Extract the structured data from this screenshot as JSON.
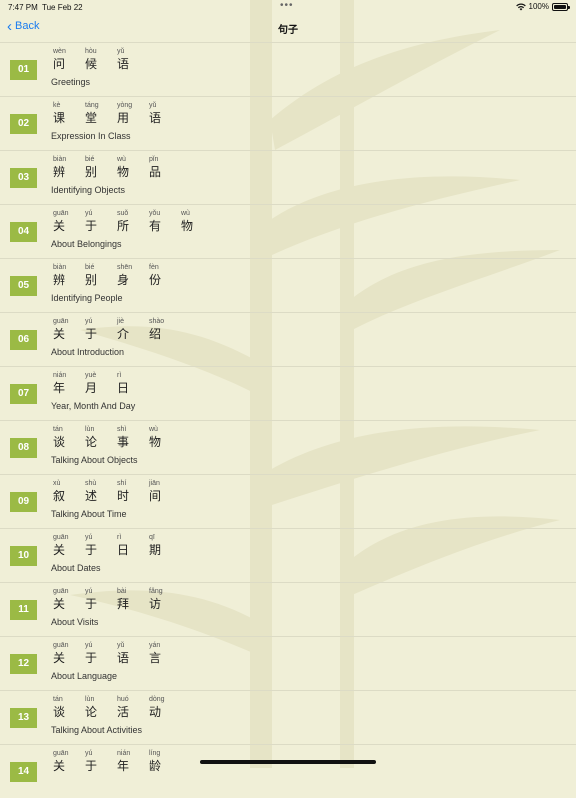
{
  "status_bar": {
    "time": "7:47 PM",
    "date": "Tue Feb 22",
    "multitask_dots": "•••",
    "battery": "100%",
    "battery_level": 1.0
  },
  "nav": {
    "back_label": "Back",
    "back_icon": "chevron-left-icon",
    "title": "句子"
  },
  "colors": {
    "background": "#f0efd7",
    "number_badge": "#9bba45",
    "link": "#1a7cf0"
  },
  "lessons": [
    {
      "number": "01",
      "english": "Greetings",
      "chars": [
        {
          "pinyin": "wèn",
          "hanzi": "问"
        },
        {
          "pinyin": "hòu",
          "hanzi": "候"
        },
        {
          "pinyin": "yǔ",
          "hanzi": "语"
        }
      ]
    },
    {
      "number": "02",
      "english": "Expression In Class",
      "chars": [
        {
          "pinyin": "kè",
          "hanzi": "课"
        },
        {
          "pinyin": "táng",
          "hanzi": "堂"
        },
        {
          "pinyin": "yòng",
          "hanzi": "用"
        },
        {
          "pinyin": "yǔ",
          "hanzi": "语"
        }
      ]
    },
    {
      "number": "03",
      "english": "Identifying Objects",
      "chars": [
        {
          "pinyin": "biàn",
          "hanzi": "辨"
        },
        {
          "pinyin": "bié",
          "hanzi": "别"
        },
        {
          "pinyin": "wù",
          "hanzi": "物"
        },
        {
          "pinyin": "pǐn",
          "hanzi": "品"
        }
      ]
    },
    {
      "number": "04",
      "english": "About Belongings",
      "chars": [
        {
          "pinyin": "guān",
          "hanzi": "关"
        },
        {
          "pinyin": "yú",
          "hanzi": "于"
        },
        {
          "pinyin": "suǒ",
          "hanzi": "所"
        },
        {
          "pinyin": "yǒu",
          "hanzi": "有"
        },
        {
          "pinyin": "wù",
          "hanzi": "物"
        }
      ]
    },
    {
      "number": "05",
      "english": "Identifying People",
      "chars": [
        {
          "pinyin": "biàn",
          "hanzi": "辨"
        },
        {
          "pinyin": "bié",
          "hanzi": "别"
        },
        {
          "pinyin": "shēn",
          "hanzi": "身"
        },
        {
          "pinyin": "fèn",
          "hanzi": "份"
        }
      ]
    },
    {
      "number": "06",
      "english": "About Introduction",
      "chars": [
        {
          "pinyin": "guān",
          "hanzi": "关"
        },
        {
          "pinyin": "yú",
          "hanzi": "于"
        },
        {
          "pinyin": "jiè",
          "hanzi": "介"
        },
        {
          "pinyin": "shào",
          "hanzi": "绍"
        }
      ]
    },
    {
      "number": "07",
      "english": "Year, Month And Day",
      "chars": [
        {
          "pinyin": "nián",
          "hanzi": "年"
        },
        {
          "pinyin": "yuè",
          "hanzi": "月"
        },
        {
          "pinyin": "rì",
          "hanzi": "日"
        }
      ]
    },
    {
      "number": "08",
      "english": "Talking About Objects",
      "chars": [
        {
          "pinyin": "tán",
          "hanzi": "谈"
        },
        {
          "pinyin": "lùn",
          "hanzi": "论"
        },
        {
          "pinyin": "shì",
          "hanzi": "事"
        },
        {
          "pinyin": "wù",
          "hanzi": "物"
        }
      ]
    },
    {
      "number": "09",
      "english": "Talking About Time",
      "chars": [
        {
          "pinyin": "xù",
          "hanzi": "叙"
        },
        {
          "pinyin": "shù",
          "hanzi": "述"
        },
        {
          "pinyin": "shí",
          "hanzi": "时"
        },
        {
          "pinyin": "jiān",
          "hanzi": "间"
        }
      ]
    },
    {
      "number": "10",
      "english": "About Dates",
      "chars": [
        {
          "pinyin": "guān",
          "hanzi": "关"
        },
        {
          "pinyin": "yú",
          "hanzi": "于"
        },
        {
          "pinyin": "rì",
          "hanzi": "日"
        },
        {
          "pinyin": "qī",
          "hanzi": "期"
        }
      ]
    },
    {
      "number": "11",
      "english": "About Visits",
      "chars": [
        {
          "pinyin": "guān",
          "hanzi": "关"
        },
        {
          "pinyin": "yú",
          "hanzi": "于"
        },
        {
          "pinyin": "bài",
          "hanzi": "拜"
        },
        {
          "pinyin": "fǎng",
          "hanzi": "访"
        }
      ]
    },
    {
      "number": "12",
      "english": "About Language",
      "chars": [
        {
          "pinyin": "guān",
          "hanzi": "关"
        },
        {
          "pinyin": "yú",
          "hanzi": "于"
        },
        {
          "pinyin": "yǔ",
          "hanzi": "语"
        },
        {
          "pinyin": "yán",
          "hanzi": "言"
        }
      ]
    },
    {
      "number": "13",
      "english": "Talking About Activities",
      "chars": [
        {
          "pinyin": "tán",
          "hanzi": "谈"
        },
        {
          "pinyin": "lùn",
          "hanzi": "论"
        },
        {
          "pinyin": "huó",
          "hanzi": "活"
        },
        {
          "pinyin": "dòng",
          "hanzi": "动"
        }
      ]
    },
    {
      "number": "14",
      "english": "",
      "chars": [
        {
          "pinyin": "guān",
          "hanzi": "关"
        },
        {
          "pinyin": "yú",
          "hanzi": "于"
        },
        {
          "pinyin": "nián",
          "hanzi": "年"
        },
        {
          "pinyin": "líng",
          "hanzi": "龄"
        }
      ]
    }
  ]
}
